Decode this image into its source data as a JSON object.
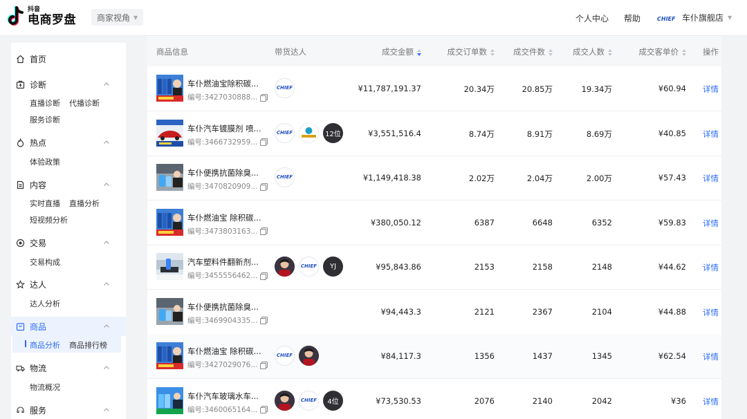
{
  "header": {
    "logo_small": "抖音",
    "logo_big": "电商罗盘",
    "view_select": "商家视角",
    "links": [
      "个人中心",
      "帮助"
    ],
    "shop_logo_text": "CHIEF",
    "shop_name": "车仆旗舰店"
  },
  "sidebar": {
    "groups": [
      {
        "label": "首页",
        "icon": "home-icon",
        "items": []
      },
      {
        "label": "诊断",
        "icon": "diagnosis-icon",
        "items": [
          "直播诊断",
          "代播诊断",
          "服务诊断"
        ]
      },
      {
        "label": "热点",
        "icon": "flame-icon",
        "items": [
          "体验政策"
        ]
      },
      {
        "label": "内容",
        "icon": "document-icon",
        "items": [
          "实时直播",
          "直播分析",
          "短视频分析"
        ]
      },
      {
        "label": "交易",
        "icon": "coin-icon",
        "items": [
          "交易构成"
        ]
      },
      {
        "label": "达人",
        "icon": "star-icon",
        "items": [
          "达人分析"
        ]
      },
      {
        "label": "商品",
        "icon": "product-icon",
        "items": [
          "商品分析",
          "商品排行榜"
        ],
        "active": true,
        "active_item": "商品分析"
      },
      {
        "label": "物流",
        "icon": "truck-icon",
        "items": [
          "物流概况"
        ]
      },
      {
        "label": "服务",
        "icon": "service-icon",
        "items": []
      }
    ]
  },
  "table": {
    "columns": [
      "商品信息",
      "带货达人",
      "成交金额",
      "成交订单数",
      "成交件数",
      "成交人数",
      "成交客单价",
      "操作"
    ],
    "detail_label": "详情",
    "rows": [
      {
        "name": "车仆燃油宝除积碳...",
        "code": "编号:3427030888...",
        "amount": "¥11,787,191.37",
        "orders": "20.34万",
        "pieces": "20.85万",
        "buyers": "19.34万",
        "avg": "¥60.94",
        "avatars": [
          "brand"
        ],
        "thumb": "blue-bottles"
      },
      {
        "name": "车仆汽车镀膜剂 喷...",
        "code": "编号:3466732959...",
        "amount": "¥3,551,516.4",
        "orders": "8.74万",
        "pieces": "8.91万",
        "buyers": "8.69万",
        "avg": "¥40.85",
        "avatars": [
          "brand",
          "badge",
          "dark"
        ],
        "dark_label": "12位",
        "thumb": "car-coating"
      },
      {
        "name": "车仆便携抗菌除臭...",
        "code": "编号:3470820909...",
        "amount": "¥1,149,418.38",
        "orders": "2.02万",
        "pieces": "2.04万",
        "buyers": "2.00万",
        "avg": "¥57.43",
        "avatars": [
          "brand"
        ],
        "thumb": "car-interior"
      },
      {
        "name": "车仆燃油宝 除积碳...",
        "code": "编号:3473803163...",
        "amount": "¥380,050.12",
        "orders": "6387",
        "pieces": "6648",
        "buyers": "6352",
        "avg": "¥59.83",
        "avatars": [],
        "thumb": "blue-bottles"
      },
      {
        "name": "汽车塑料件翻新剂...",
        "code": "编号:3455556462...",
        "amount": "¥95,843.86",
        "orders": "2153",
        "pieces": "2158",
        "buyers": "2148",
        "avg": "¥44.62",
        "avatars": [
          "person",
          "brand",
          "dark"
        ],
        "dark_label": "YJ",
        "thumb": "car-plastic"
      },
      {
        "name": "车仆便携抗菌除臭...",
        "code": "编号:3469904335...",
        "amount": "¥94,443.3",
        "orders": "2121",
        "pieces": "2367",
        "buyers": "2104",
        "avg": "¥44.88",
        "avatars": [],
        "thumb": "car-interior"
      },
      {
        "name": "车仆燃油宝 除积碳...",
        "code": "编号:3427029076...",
        "amount": "¥84,117.3",
        "orders": "1356",
        "pieces": "1437",
        "buyers": "1345",
        "avg": "¥62.54",
        "avatars": [
          "brand",
          "person"
        ],
        "thumb": "blue-bottles"
      },
      {
        "name": "车仆汽车玻璃水车...",
        "code": "编号:3460065164...",
        "amount": "¥73,530.53",
        "orders": "2076",
        "pieces": "2140",
        "buyers": "2042",
        "avg": "¥36",
        "avatars": [
          "person",
          "brand",
          "dark"
        ],
        "dark_label": "4位",
        "thumb": "glass-water"
      }
    ]
  },
  "colors": {
    "accent": "#2a6cf6",
    "active_bg": "#edf3fe",
    "header_bg": "#f6f7f9"
  }
}
